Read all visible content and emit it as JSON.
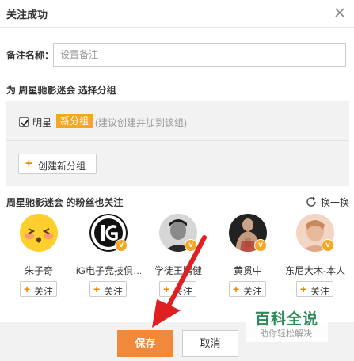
{
  "dialog": {
    "title": "关注成功"
  },
  "remark": {
    "label": "备注名称：",
    "placeholder": "设置备注",
    "value": ""
  },
  "group": {
    "heading": "为 周星驰影迷会 选择分组",
    "items": [
      {
        "name": "明星",
        "checked": true
      }
    ],
    "new_badge": "新分组",
    "hint": "(建议创建并加到该组)",
    "create_label": "创建新分组"
  },
  "fans": {
    "heading": "周星驰影迷会 的粉丝也关注",
    "refresh_label": "换一换",
    "follow_label": "关注",
    "users": [
      {
        "name": "朱子奇",
        "verified": false,
        "avatar": "emoji-face"
      },
      {
        "name": "iG电子竞技俱…",
        "verified": true,
        "avatar": "ig-logo"
      },
      {
        "name": "学徒王鹏健",
        "verified": true,
        "avatar": "portrait"
      },
      {
        "name": "黄贯中",
        "verified": true,
        "avatar": "portrait"
      },
      {
        "name": "东尼大木-本人",
        "verified": true,
        "avatar": "portrait"
      }
    ]
  },
  "footer": {
    "save_label": "保存",
    "cancel_label": "取消"
  },
  "watermark": {
    "main": "百科全说",
    "sub": "助你轻松解决"
  },
  "colors": {
    "accent_orange": "#f08a3a",
    "badge_yellow": "#f5a623",
    "annotation_red": "#e02020",
    "watermark_green": "#2e8b57"
  }
}
